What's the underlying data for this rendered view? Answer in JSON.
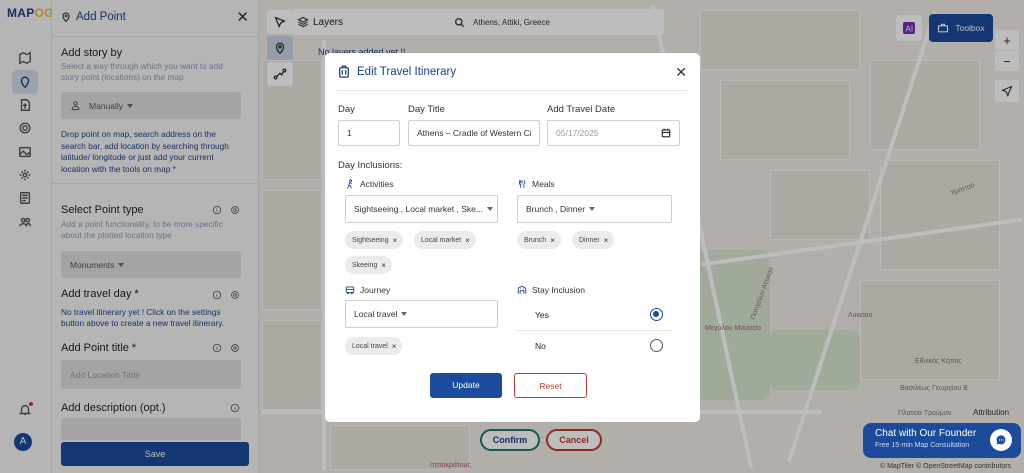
{
  "app": {
    "logo_main": "MAP",
    "logo_accent": "OG"
  },
  "panel": {
    "title": "Add Point",
    "close": "✕",
    "story": {
      "heading": "Add story by",
      "desc": "Select a way through which you want to add story point (locations) on the map",
      "value": "Manually",
      "help": "Drop point on map, search address on the search bar, add location by searching through latitude/ longitude or just add your current location with the tools on map *"
    },
    "point_type": {
      "heading": "Select Point type",
      "desc": "Add a point functionality, to be more specific about the plotted location type",
      "value": "Monuments"
    },
    "travel_day": {
      "heading": "Add travel day *",
      "desc": "No travel itinerary yet ! Click on the settings button above to create a new travel itinerary."
    },
    "point_title": {
      "heading": "Add Point title *",
      "placeholder": "Add Location Tittle"
    },
    "description": {
      "heading": "Add description (opt.)"
    },
    "save_label": "Save"
  },
  "map": {
    "layers_label": "Layers",
    "layers_empty": "No layers added yet !!",
    "search_value": "Athens, Attiki, Greece",
    "toolbox_label": "Toolbox",
    "zoom_in": "+",
    "zoom_out": "−",
    "confirm_label": "Confirm",
    "cancel_label": "Cancel",
    "attribution": "Attribution",
    "copyright": "© MapTiler © OpenStreetMap contributors",
    "labels": [
      "Υμηττού",
      "Πατησίων Αττικού",
      "Λυκείου",
      "Μεγάλου Μουσείο",
      "Εθνικός Κήπος",
      "Βασιλέως Γεωργίου Β",
      "Πλατεία Τρούμαν",
      "Ιπποκράτους"
    ]
  },
  "chat": {
    "title": "Chat with Our Founder",
    "subtitle": "Free 15-min Map Consultation"
  },
  "modal": {
    "title": "Edit Travel Itinerary",
    "close": "✕",
    "day_label": "Day",
    "day_value": "1",
    "day_title_label": "Day Title",
    "day_title_value": "Athens – Cradle of Western Ci",
    "date_label": "Add Travel Date",
    "date_value": "05/17/2025",
    "inclusions_label": "Day Inclusions:",
    "activities": {
      "label": "Activities",
      "value": "Sightseeing , Local market , Ske...",
      "chips": [
        "Sightseeing",
        "Local market",
        "Skeeing"
      ]
    },
    "meals": {
      "label": "Meals",
      "value": "Brunch , Dinner",
      "chips": [
        "Brunch",
        "Dinner"
      ]
    },
    "journey": {
      "label": "Journey",
      "value": "Local travel",
      "chips": [
        "Local travel"
      ]
    },
    "stay": {
      "label": "Stay Inclusion",
      "options": [
        "Yes",
        "No"
      ],
      "selected": "Yes"
    },
    "update_label": "Update",
    "reset_label": "Reset"
  },
  "colors": {
    "primary": "#1c4b9c",
    "reset_border": "#c0392b",
    "confirm_border": "#1a7a6e"
  }
}
